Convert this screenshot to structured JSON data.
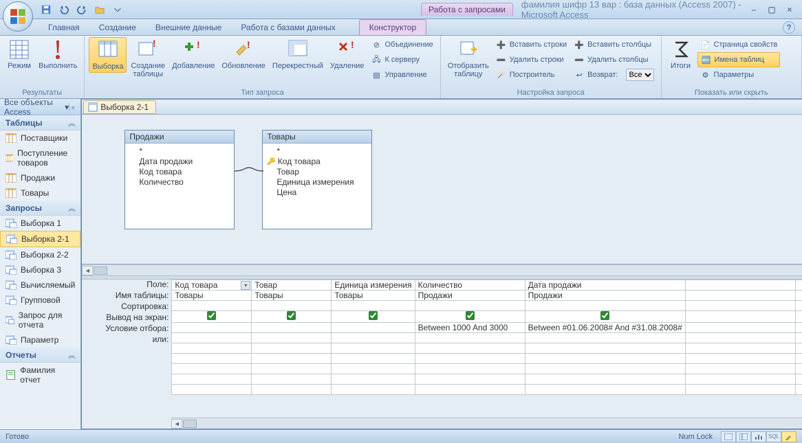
{
  "titlebar": {
    "contextual": "Работа с запросами",
    "title": "фамилия шифр 13 вар : база данных (Access 2007) - Microsoft Access"
  },
  "tabs": {
    "home": "Главная",
    "create": "Создание",
    "external": "Внешние данные",
    "dbtools": "Работа с базами данных",
    "design": "Конструктор"
  },
  "ribbon": {
    "group1": {
      "label": "Результаты",
      "view": "Режим",
      "run": "Выполнить"
    },
    "group2": {
      "label": "Тип запроса",
      "select": "Выборка",
      "maketable": "Создание\nтаблицы",
      "append": "Добавление",
      "update": "Обновление",
      "crosstab": "Перекрестный",
      "delete": "Удаление",
      "union": "Объединение",
      "passthrough": "К серверу",
      "datadef": "Управление"
    },
    "group3": {
      "label": "Настройка запроса",
      "showtable": "Отобразить\nтаблицу",
      "insrows": "Вставить строки",
      "delrows": "Удалить строки",
      "builder": "Построитель",
      "inscols": "Вставить столбцы",
      "delcols": "Удалить столбцы",
      "return": "Возврат:",
      "return_val": "Все"
    },
    "group4": {
      "label": "Показать или скрыть",
      "totals": "Итоги",
      "propsheet": "Страница свойств",
      "tablenames": "Имена таблиц",
      "params": "Параметры"
    }
  },
  "navpane": {
    "title": "Все объекты Access",
    "tables_h": "Таблицы",
    "tables": [
      "Поставщики",
      "Поступление товаров",
      "Продажи",
      "Товары"
    ],
    "queries_h": "Запросы",
    "queries": [
      "Выборка 1",
      "Выборка 2-1",
      "Выборка 2-2",
      "Выборка 3",
      "Вычисляемый",
      "Групповой",
      "Запрос для отчета",
      "Параметр"
    ],
    "reports_h": "Отчеты",
    "reports": [
      "Фамилия отчет"
    ]
  },
  "doctab": "Выборка 2-1",
  "tablebox1": {
    "title": "Продажи",
    "star": "*",
    "fields": [
      "Дата продажи",
      "Код товара",
      "Количество"
    ]
  },
  "tablebox2": {
    "title": "Товары",
    "star": "*",
    "keyfield": "Код товара",
    "fields": [
      "Товар",
      "Единица измерения",
      "Цена"
    ]
  },
  "grid": {
    "labels": {
      "field": "Поле:",
      "table": "Имя таблицы:",
      "sort": "Сортировка:",
      "show": "Вывод на экран:",
      "criteria": "Условие отбора:",
      "or": "или:"
    },
    "cols": [
      {
        "field": "Код товара",
        "table": "Товары",
        "show": true,
        "criteria": "",
        "dd": true
      },
      {
        "field": "Товар",
        "table": "Товары",
        "show": true,
        "criteria": ""
      },
      {
        "field": "Единица измерения",
        "table": "Товары",
        "show": true,
        "criteria": ""
      },
      {
        "field": "Количество",
        "table": "Продажи",
        "show": true,
        "criteria": "Between 1000 And 3000"
      },
      {
        "field": "Дата продажи",
        "table": "Продажи",
        "show": true,
        "criteria": "Between #01.06.2008# And #31.08.2008#"
      },
      {
        "field": "",
        "table": "",
        "show": false,
        "criteria": ""
      },
      {
        "field": "",
        "table": "",
        "show": false,
        "criteria": "",
        "lastshow": true
      }
    ]
  },
  "statusbar": {
    "ready": "Готово",
    "numlock": "Num Lock"
  }
}
